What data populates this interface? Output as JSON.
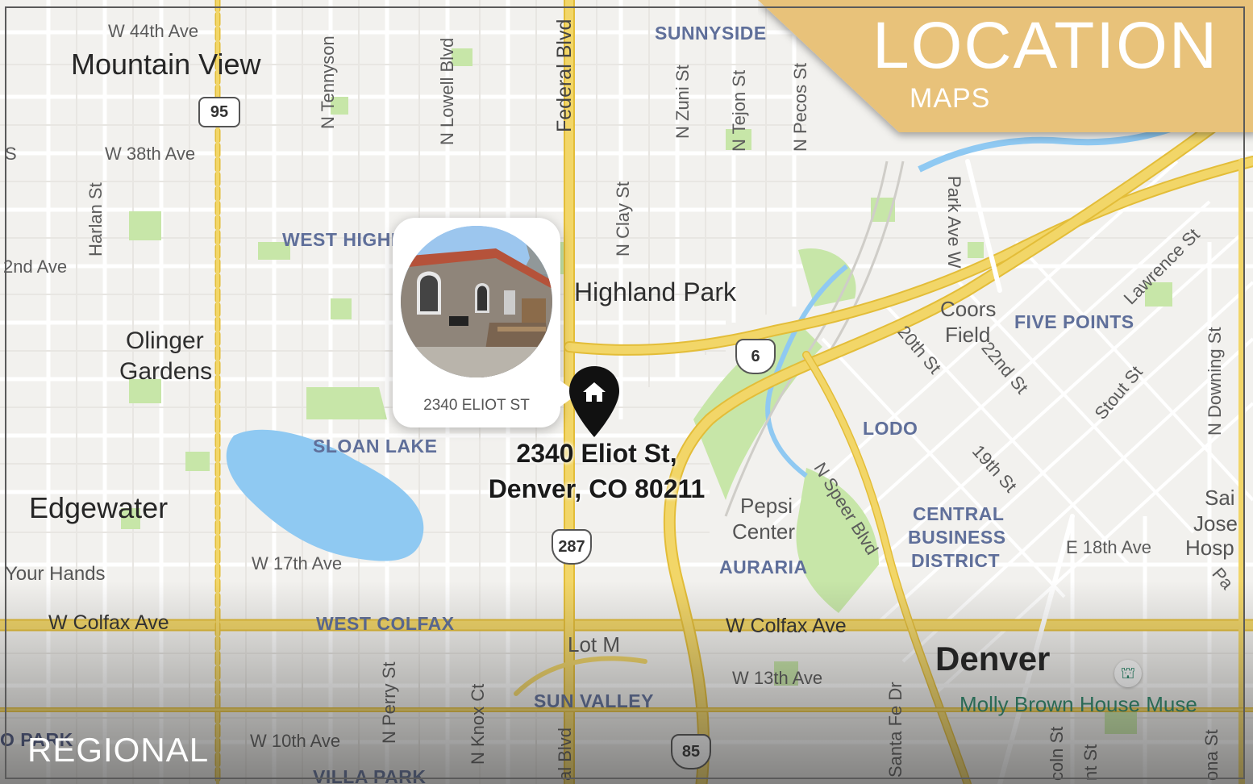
{
  "banner": {
    "title": "LOCATION",
    "subtitle": "MAPS",
    "color": "#e8c27a"
  },
  "footer_label": "REGIONAL",
  "property": {
    "card_caption": "2340 ELIOT ST",
    "address_line1": "2340 Eliot St,",
    "address_line2": "Denver, CO 80211",
    "pin_icon": "home-pin-icon"
  },
  "places": {
    "mountain_view": "Mountain View",
    "olinger_gardens_1": "Olinger",
    "olinger_gardens_2": "Gardens",
    "highland_park": "Highland Park",
    "edgewater": "Edgewater",
    "denver": "Denver",
    "pepsi_center_1": "Pepsi",
    "pepsi_center_2": "Center",
    "coors_field_1": "Coors",
    "coors_field_2": "Field",
    "lot_m": "Lot M",
    "saint_joseph_1": "Sai",
    "saint_joseph_2": "Jose",
    "saint_joseph_3": "Hosp",
    "your_hands": "Your Hands",
    "molly_brown": "Molly Brown House Muse"
  },
  "neighborhoods": {
    "sunnyside": "SUNNYSIDE",
    "west_highland": "WEST HIGHL",
    "sloan_lake": "SLOAN LAKE",
    "five_points": "FIVE POINTS",
    "lodo": "LODO",
    "cbd_1": "CENTRAL",
    "cbd_2": "BUSINESS",
    "cbd_3": "DISTRICT",
    "auraria": "AURARIA",
    "west_colfax": "WEST COLFAX",
    "sun_valley": "SUN VALLEY",
    "villa_park": "VILLA PARK",
    "left_edge": "O PARK"
  },
  "streets": {
    "w44": "W 44th Ave",
    "w38": "W 38th Ave",
    "w38_s": "S",
    "w32": "2nd Ave",
    "w17": "W 17th Ave",
    "colfax_w": "W Colfax Ave",
    "colfax_e": "W Colfax Ave",
    "w13": "W 13th Ave",
    "w10": "W 10th Ave",
    "e18": "E 18th Ave",
    "tennyson": "N Tennyson",
    "lowell": "N Lowell Blvd",
    "federal": "Federal Blvd",
    "federal_s": "al Blvd",
    "zuni": "N Zuni St",
    "tejon": "N Tejon St",
    "pecos": "N Pecos St",
    "clay": "N Clay St",
    "harlan": "Harlan St",
    "perry": "N Perry St",
    "knox": "N Knox Ct",
    "santa_fe": "Santa Fe Dr",
    "park_ave": "Park Ave W",
    "lawrence": "Lawrence St",
    "downing": "N Downing St",
    "st20": "20th St",
    "st22": "22nd St",
    "stout": "Stout St",
    "st19": "19th St",
    "speer": "N Speer Blvd",
    "lincoln": "coln St",
    "grant": "nt St",
    "corona": "ona St",
    "pa": "Pa"
  },
  "shields": {
    "r95": "95",
    "r6": "6",
    "r287": "287",
    "r85": "85"
  },
  "colors": {
    "water": "#8fc9f2",
    "park": "#c7e6a8",
    "highway": "#f2d668",
    "highway_edge": "#e3bd38",
    "road": "#ffffff",
    "land": "#f2f1ee"
  }
}
